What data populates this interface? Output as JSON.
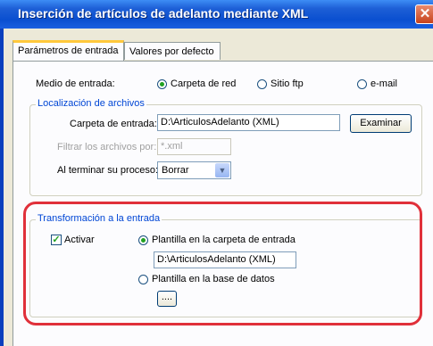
{
  "window": {
    "title": "Inserción de artículos de adelanto mediante XML",
    "close_glyph": "✕"
  },
  "tabs": [
    {
      "label": "Parámetros de entrada"
    },
    {
      "label": "Valores por defecto"
    }
  ],
  "medio": {
    "label": "Medio de entrada:",
    "options": [
      {
        "label": "Carpeta de red",
        "selected": true
      },
      {
        "label": "Sitio ftp",
        "selected": false
      },
      {
        "label": "e-mail",
        "selected": false
      }
    ]
  },
  "localizacion": {
    "legend": "Localización de archivos",
    "carpeta_label": "Carpeta de entrada:",
    "carpeta_value": "D:\\ArticulosAdelanto (XML)",
    "examinar_label": "Examinar",
    "filtrar_label": "Filtrar los archivos por:",
    "filtrar_value": "*.xml",
    "terminar_label": "Al terminar su proceso:",
    "terminar_value": "Borrar"
  },
  "transformacion": {
    "legend": "Transformación a la entrada",
    "activar_label": "Activar",
    "activar_checked": true,
    "opcion_carpeta": "Plantilla en la carpeta de entrada",
    "plantilla_value": "D:\\ArticulosAdelanto (XML)",
    "opcion_bd": "Plantilla en la base de datos",
    "ellipsis_label": "...."
  },
  "colors": {
    "highlight": "#e0303a",
    "title_bar": "#0a4fd0",
    "group_legend": "#0046d5"
  }
}
